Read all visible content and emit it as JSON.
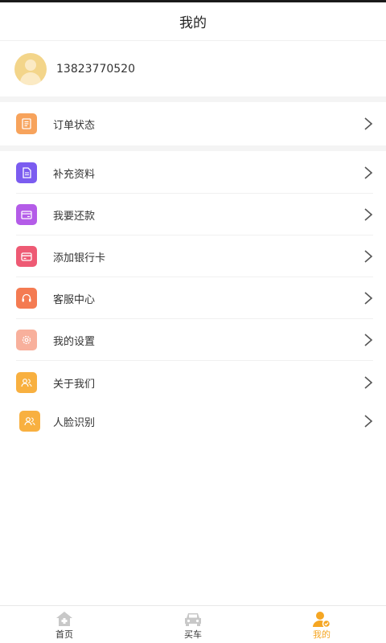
{
  "header": {
    "title": "我的"
  },
  "profile": {
    "phone": "13823770520",
    "avatar_icon": "user-avatar-icon"
  },
  "menu": {
    "group1": [
      {
        "label": "订单状态",
        "icon": "order-document-icon",
        "color": "#f7a35c"
      }
    ],
    "group2": [
      {
        "label": "补充资料",
        "icon": "document-icon",
        "color": "#7b5cf0"
      },
      {
        "label": "我要还款",
        "icon": "repay-card-icon",
        "color": "#b45ce8"
      },
      {
        "label": "添加银行卡",
        "icon": "bank-card-icon",
        "color": "#ee5a74"
      },
      {
        "label": "客服中心",
        "icon": "headset-icon",
        "color": "#f47b52"
      },
      {
        "label": "我的设置",
        "icon": "settings-gear-icon",
        "color": "#f8b09c"
      },
      {
        "label": "关于我们",
        "icon": "users-icon",
        "color": "#f8b040"
      },
      {
        "label": "人脸识别",
        "icon": "face-id-icon",
        "color": "#f8b040"
      }
    ]
  },
  "tabbar": {
    "tabs": [
      {
        "label": "首页",
        "icon": "home-icon",
        "active": false
      },
      {
        "label": "买车",
        "icon": "car-icon",
        "active": false
      },
      {
        "label": "我的",
        "icon": "profile-icon",
        "active": true
      }
    ],
    "active_color": "#f5a623"
  }
}
